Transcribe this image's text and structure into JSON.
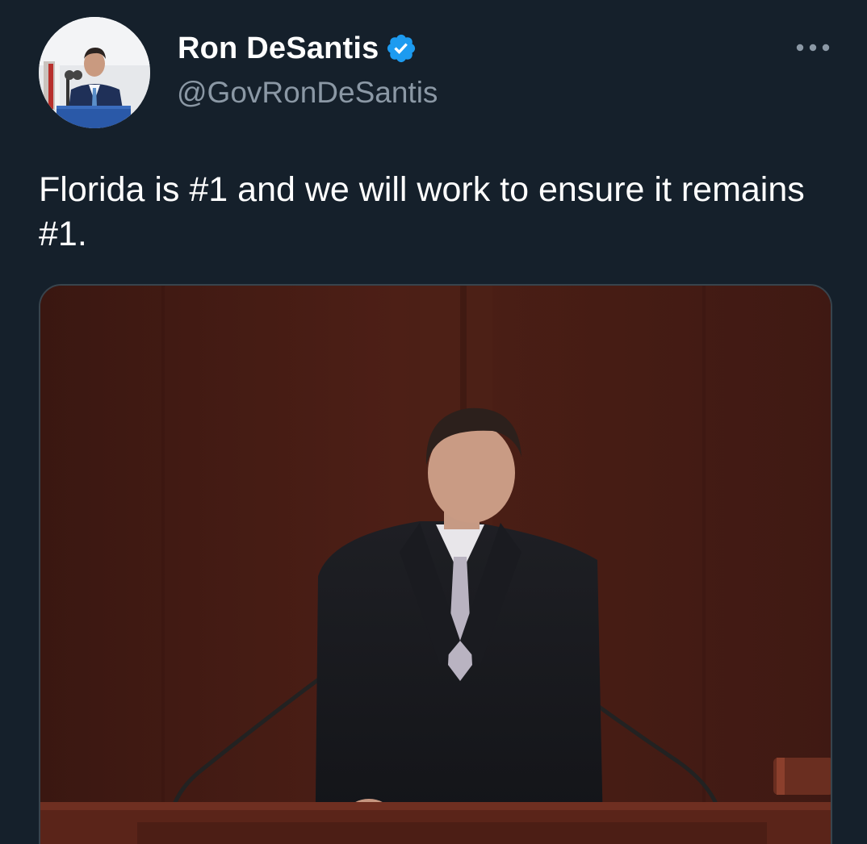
{
  "author": {
    "display_name": "Ron DeSantis",
    "handle": "@GovRonDeSantis",
    "verified": true,
    "verified_color": "#1d9bf0"
  },
  "tweet": {
    "text": "Florida is #1 and we will work to ensure it remains #1."
  },
  "media": {
    "type": "video-still",
    "description_icon": "photo"
  },
  "icons": {
    "more": "more-horizontal-icon",
    "verified": "verified-badge-icon"
  },
  "colors": {
    "background": "#15202b",
    "text_primary": "#ffffff",
    "text_secondary": "#8b98a5",
    "accent": "#1d9bf0"
  }
}
